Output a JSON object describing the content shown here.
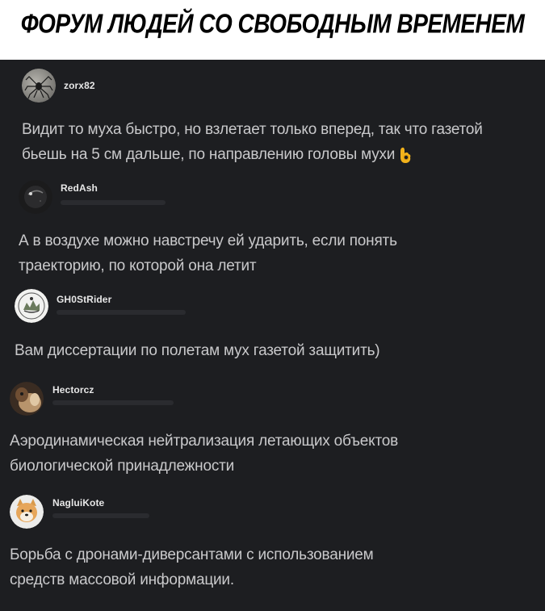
{
  "header": {
    "title": "ФОРУМ ЛЮДЕЙ СО СВОБОДНЫМ ВРЕМЕНЕМ"
  },
  "comments": [
    {
      "username": "zorx82",
      "text": "Видит то муха быстро, но взлетает только вперед, так что газетой\nбьешь на 5 см дальше, по направлению головы мухи",
      "emoji": "ok-hand-icon"
    },
    {
      "username": "RedAsh",
      "text": "А в воздухе можно навстречу ей ударить, если понять\nтраекторию, по которой она летит"
    },
    {
      "username": "GH0StRider",
      "text": "Вам диссертации по полетам мух газетой защитить)"
    },
    {
      "username": "Hectorcz",
      "text": "Аэродинамическая нейтрализация летающих объектов\nбиологической принадлежности"
    },
    {
      "username": "NagluiKote",
      "text": "Борьба с дронами-диверсантами с использованием\nсредств массовой информации."
    }
  ],
  "colors": {
    "background": "#1d1e21",
    "header_bg": "#ffffff",
    "text": "#c9c9cb",
    "username": "#e7e7e7"
  }
}
